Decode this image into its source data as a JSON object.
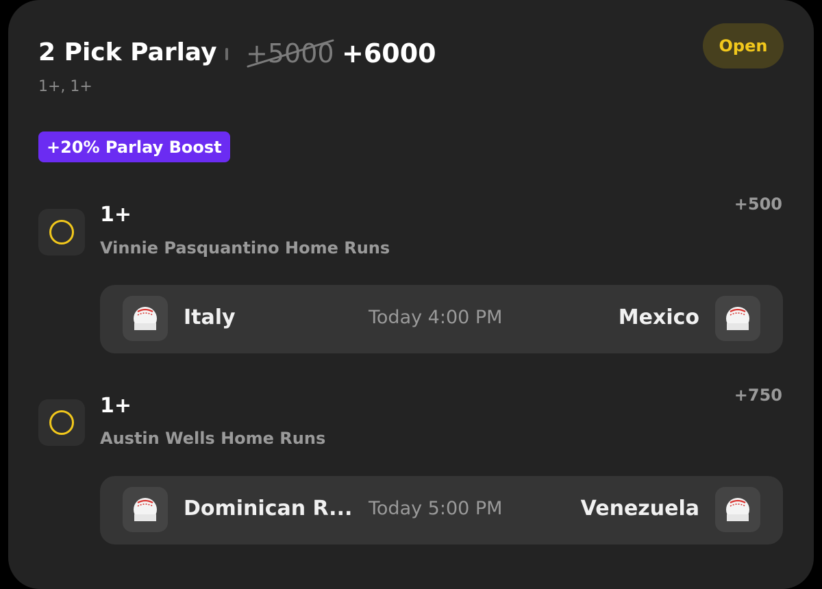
{
  "header": {
    "title": "2 Pick Parlay",
    "old_odds": "+5000",
    "new_odds": "+6000",
    "status": "Open",
    "subtitle": "1+, 1+",
    "boost": "+20% Parlay Boost"
  },
  "picks": [
    {
      "line": "1+",
      "description": "Vinnie Pasquantino Home Runs",
      "odds": "+500",
      "game": {
        "away_team": "Italy",
        "time": "Today 4:00 PM",
        "home_team": "Mexico"
      }
    },
    {
      "line": "1+",
      "description": "Austin Wells Home Runs",
      "odds": "+750",
      "game": {
        "away_team": "Dominican R...",
        "time": "Today 5:00 PM",
        "home_team": "Venezuela"
      }
    }
  ],
  "icons": {
    "pick_status": "circle-outline-icon",
    "team": "baseball-icon"
  },
  "colors": {
    "background": "#232323",
    "accent_yellow": "#f2c81c",
    "boost_purple": "#6b2cf2",
    "row_bg": "#353535"
  }
}
